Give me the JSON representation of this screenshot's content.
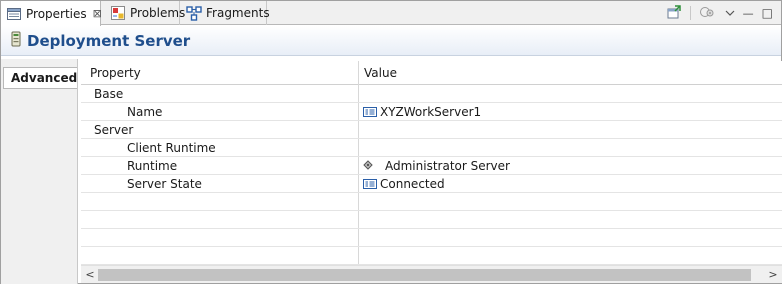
{
  "tabs": [
    {
      "label": "Properties",
      "icon": "properties-icon",
      "close": "⊠"
    },
    {
      "label": "Problems",
      "icon": "problems-icon"
    },
    {
      "label": "Fragments",
      "icon": "fragments-icon"
    }
  ],
  "toolbar": {
    "pin_icon": "pin-icon",
    "filter_icon": "filter-icon",
    "menu_icon": "view-menu-icon",
    "minimize_label": "—",
    "maximize_label": "□"
  },
  "header": {
    "title": "Deployment Server",
    "icon": "server-icon"
  },
  "sidebar": {
    "tabs": [
      {
        "label": "Advanced"
      }
    ]
  },
  "table": {
    "columns": [
      "Property",
      "Value"
    ],
    "rows": [
      {
        "property": "Base",
        "value": "",
        "indent": 0,
        "value_icon": ""
      },
      {
        "property": "Name",
        "value": "XYZWorkServer1",
        "indent": 1,
        "value_icon": "text-field-icon"
      },
      {
        "property": "Server",
        "value": "",
        "indent": 0,
        "value_icon": ""
      },
      {
        "property": "Client Runtime",
        "value": "",
        "indent": 1,
        "value_icon": ""
      },
      {
        "property": "Runtime",
        "value": "Administrator Server",
        "indent": 1,
        "value_icon": "runtime-icon"
      },
      {
        "property": "Server State",
        "value": "Connected",
        "indent": 1,
        "value_icon": "text-field-icon"
      }
    ]
  },
  "scrollbar": {
    "left_arrow": "<",
    "right_arrow": ">"
  },
  "colors": {
    "title": "#1f4e8c",
    "tab_bg": "#f0f0f0",
    "border": "#b8b8b8"
  }
}
